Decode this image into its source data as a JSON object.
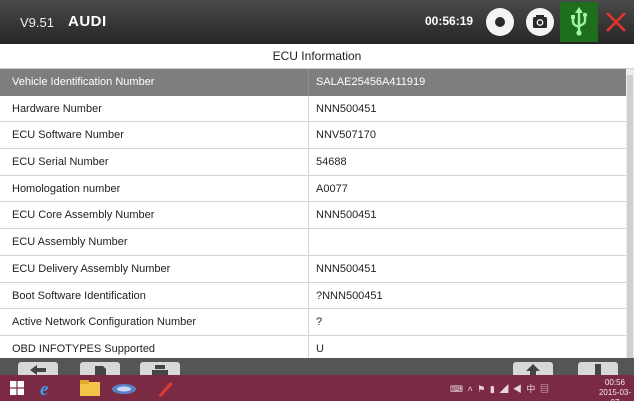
{
  "topbar": {
    "version": "V9.51",
    "make": "AUDI",
    "time": "00:56:19"
  },
  "screen_title": "ECU Information",
  "rows": [
    {
      "name": "Vehicle Identification Number",
      "value": "SALAE25456A411919"
    },
    {
      "name": "Hardware Number",
      "value": "NNN500451"
    },
    {
      "name": "ECU Software Number",
      "value": "NNV507170"
    },
    {
      "name": "ECU Serial Number",
      "value": "54688"
    },
    {
      "name": "Homologation number",
      "value": "A0077"
    },
    {
      "name": "ECU Core Assembly Number",
      "value": "NNN500451"
    },
    {
      "name": "ECU Assembly Number",
      "value": ""
    },
    {
      "name": "ECU Delivery Assembly Number",
      "value": "NNN500451"
    },
    {
      "name": "Boot Software Identification",
      "value": "?NNN500451"
    },
    {
      "name": "Active Network Configuration Number",
      "value": "?"
    },
    {
      "name": "OBD INFOTYPES Supported",
      "value": "U"
    }
  ],
  "taskbar": {
    "clock_time": "00:56",
    "clock_date": "2015-03-07",
    "tray_ime": "中"
  },
  "colors": {
    "topbar": "#333333",
    "selected_row": "#7e7e7e",
    "usb_active": "#1e6e1e",
    "close": "#e8332a",
    "taskbar": "#7a2a42"
  }
}
